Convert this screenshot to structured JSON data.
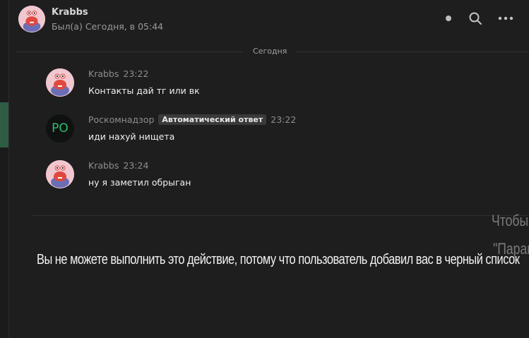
{
  "header": {
    "name": "Krabbs",
    "status": "Был(а) Сегодня, в 05:44",
    "icons": [
      "status-dot-icon",
      "search-icon",
      "more-icon"
    ]
  },
  "date_divider": "Сегодня",
  "messages": [
    {
      "author": "Krabbs",
      "time": "23:22",
      "text": "Контакты дай тг или вк"
    },
    {
      "author": "Роскомнадзор",
      "avatar_initials": "PO",
      "badge": "Автоматический ответ",
      "time": "23:22",
      "text": "иди нахуй нищета"
    },
    {
      "author": "Krabbs",
      "time": "23:24",
      "text": "ну я заметил обрыган"
    }
  ],
  "blocked_notice": "Вы не можете выполнить это действие, потому что пользователь добавил вас в черный список",
  "overlay_fragments": [
    "Чтобы",
    "\"Парам"
  ],
  "colors": {
    "background": "#1e1e1f",
    "accent_green": "#2f5c45",
    "po_green": "#2fbf71",
    "badge_bg": "#3a3a3c"
  }
}
